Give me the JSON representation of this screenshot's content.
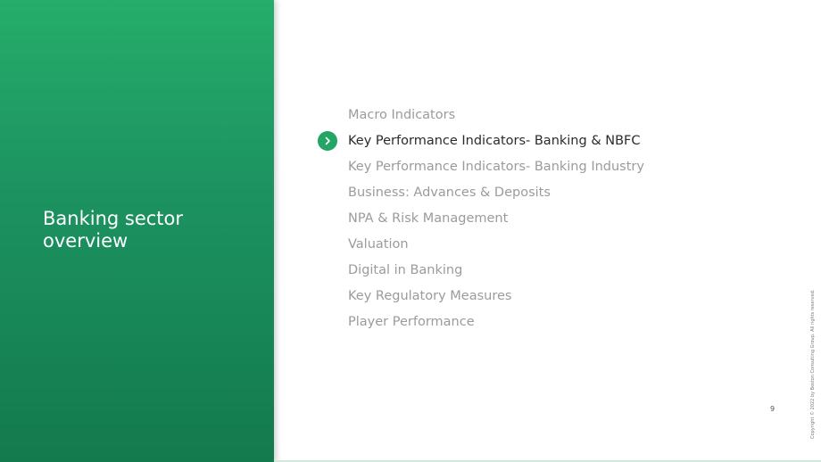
{
  "section": {
    "title": "Banking sector overview"
  },
  "agenda": {
    "items": [
      {
        "label": "Macro Indicators",
        "active": false
      },
      {
        "label": "Key Performance Indicators- Banking & NBFC",
        "active": true
      },
      {
        "label": "Key Performance Indicators- Banking Industry",
        "active": false
      },
      {
        "label": "Business: Advances & Deposits",
        "active": false
      },
      {
        "label": "NPA & Risk Management",
        "active": false
      },
      {
        "label": "Valuation",
        "active": false
      },
      {
        "label": "Digital in Banking",
        "active": false
      },
      {
        "label": "Key Regulatory Measures",
        "active": false
      },
      {
        "label": "Player Performance",
        "active": false
      }
    ],
    "active_icon": "chevron-right-icon"
  },
  "footer": {
    "page_number": "9",
    "copyright": "Copyright © 2022 by Boston Consulting Group. All rights reserved."
  },
  "colors": {
    "accent": "#22a565",
    "panel_top": "#25ad6a",
    "panel_bottom": "#137a4d",
    "inactive_text": "#9b9b9b",
    "active_text": "#2b2b2b"
  }
}
